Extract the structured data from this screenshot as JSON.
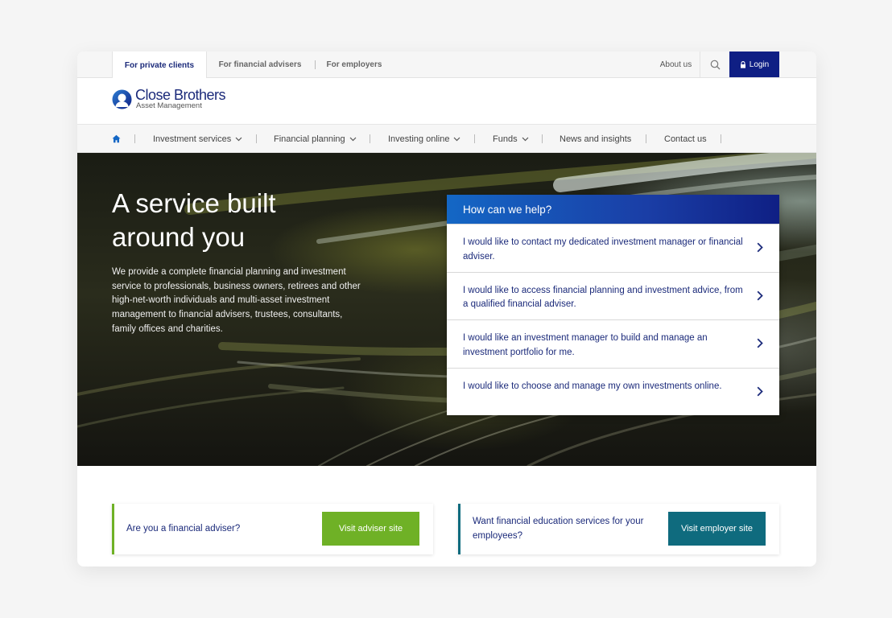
{
  "topbar": {
    "tabs": [
      {
        "label": "For private clients",
        "active": true
      },
      {
        "label": "For financial advisers",
        "active": false
      },
      {
        "label": "For employers",
        "active": false
      }
    ],
    "about": "About us",
    "login": "Login"
  },
  "brand": {
    "name": "Close Brothers",
    "sub": "Asset Management"
  },
  "nav": {
    "items": [
      {
        "label": "Investment services",
        "dropdown": true
      },
      {
        "label": "Financial planning",
        "dropdown": true
      },
      {
        "label": "Investing online",
        "dropdown": true
      },
      {
        "label": "Funds",
        "dropdown": true
      },
      {
        "label": "News and insights",
        "dropdown": false
      },
      {
        "label": "Contact us",
        "dropdown": false
      }
    ]
  },
  "hero": {
    "title_line1": "A service built",
    "title_line2": "around you",
    "description": "We provide a complete financial planning and investment service to professionals, business owners, retirees and other high-net-worth individuals and multi-asset investment management to financial advisers, trustees, consultants, family offices and charities."
  },
  "help": {
    "heading": "How can we help?",
    "options": [
      "I would like to contact my dedicated investment manager or financial adviser.",
      "I would like to access financial planning and investment advice, from a qualified financial adviser.",
      "I would like an investment manager to build and manage an investment portfolio for me.",
      "I would like to choose and manage my own investments online."
    ]
  },
  "ctas": {
    "adviser": {
      "text": "Are you a financial adviser?",
      "button": "Visit adviser site"
    },
    "employer": {
      "text": "Want financial education services for your employees?",
      "button": "Visit employer site"
    }
  },
  "colors": {
    "brand_navy": "#0f1f84",
    "adviser_green": "#6fb126",
    "employer_teal": "#0f6b7e"
  },
  "icons": {
    "home": "home-icon",
    "search": "search-icon",
    "lock": "lock-icon",
    "chevron": "chevron-down-icon",
    "arrow": "chevron-right-icon"
  }
}
